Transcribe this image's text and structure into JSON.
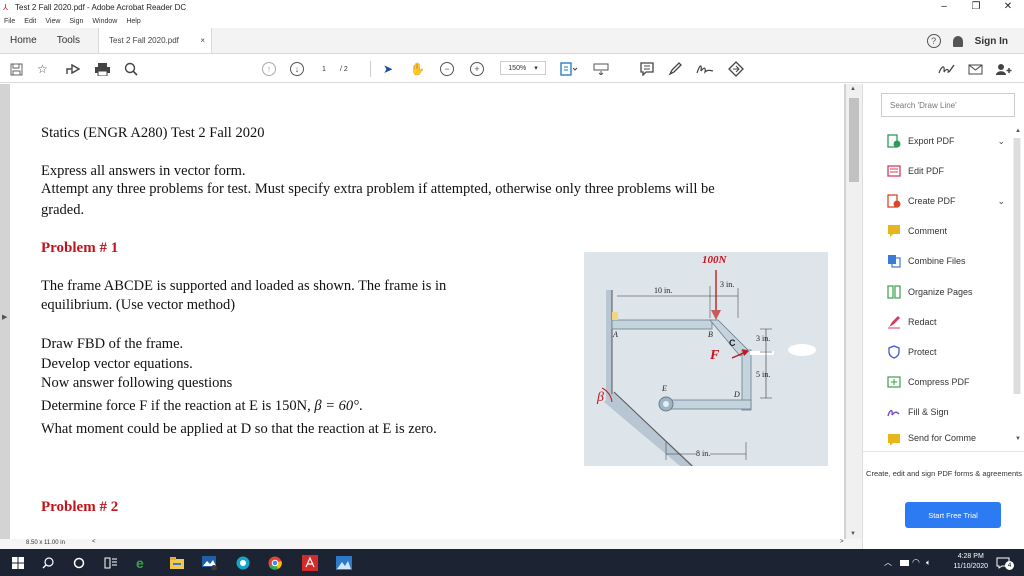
{
  "window": {
    "title": "Test 2 Fall 2020.pdf - Adobe Acrobat Reader DC",
    "minimize": "–",
    "maximize": "❐",
    "close": "✕"
  },
  "menu": [
    "File",
    "Edit",
    "View",
    "Sign",
    "Window",
    "Help"
  ],
  "tabs": {
    "home": "Home",
    "tools": "Tools",
    "doc": "Test 2 Fall 2020.pdf",
    "doc_close": "×"
  },
  "header_right": {
    "help": "?",
    "signin": "Sign In"
  },
  "toolbar": {
    "page_current": "1",
    "page_total": "/ 2",
    "zoom": "150%"
  },
  "document": {
    "title": "Statics (ENGR A280) Test 2 Fall 2020",
    "instr1": "Express all answers in vector form.",
    "instr2a": "Attempt any three problems for test. Must specify extra problem if attempted, otherwise only three problems will be",
    "instr2b": "graded.",
    "problem1": "Problem # 1",
    "p1_desc1": "The frame ABCDE is supported and loaded as shown. The frame is in",
    "p1_desc2": "equilibrium.  (Use vector method)",
    "p1_task1": "Draw FBD of the frame.",
    "p1_task2": "Develop vector equations.",
    "p1_task3": "Now answer following questions",
    "p1_q1_pre": "Determine force F if the reaction at E is 150N,",
    "p1_q1_beta": "β = 60°",
    "p1_q1_post": ".",
    "p1_q2": "What moment could be applied at D so that the reaction at E is zero.",
    "problem2": "Problem # 2"
  },
  "figure": {
    "load": "100N",
    "dim_10in": "10 in.",
    "dim_3in_top": "3 in.",
    "dim_3in_right": "3 in.",
    "dim_5in": "5 in.",
    "dim_8in": "8 in.",
    "label_A": "A",
    "label_B": "B",
    "label_C": "C",
    "label_D": "D",
    "label_E": "E",
    "label_F": "F",
    "label_beta": "β"
  },
  "status": {
    "page_size": "8.50 x 11.00 in",
    "scroll_left": "<",
    "scroll_right": ">"
  },
  "right_panel": {
    "search_placeholder": "Search 'Draw Line'",
    "tools": [
      {
        "label": "Export PDF",
        "icon": "export-pdf-icon",
        "color": "#2c9a5a",
        "has_chevron": true
      },
      {
        "label": "Edit PDF",
        "icon": "edit-pdf-icon",
        "color": "#d83b5f",
        "has_chevron": false
      },
      {
        "label": "Create PDF",
        "icon": "create-pdf-icon",
        "color": "#d9482b",
        "has_chevron": true
      },
      {
        "label": "Comment",
        "icon": "comment-icon",
        "color": "#e7b61e",
        "has_chevron": false
      },
      {
        "label": "Combine Files",
        "icon": "combine-files-icon",
        "color": "#3a7bd5",
        "has_chevron": false
      },
      {
        "label": "Organize Pages",
        "icon": "organize-pages-icon",
        "color": "#3aa14a",
        "has_chevron": false
      },
      {
        "label": "Redact",
        "icon": "redact-icon",
        "color": "#d83b5f",
        "has_chevron": false
      },
      {
        "label": "Protect",
        "icon": "protect-icon",
        "color": "#3a5bd5",
        "has_chevron": false
      },
      {
        "label": "Compress PDF",
        "icon": "compress-pdf-icon",
        "color": "#3aa14a",
        "has_chevron": false
      },
      {
        "label": "Fill & Sign",
        "icon": "fill-sign-icon",
        "color": "#7a4ad5",
        "has_chevron": false
      },
      {
        "label": "Send for Comme",
        "icon": "send-comment-icon",
        "color": "#e7b61e",
        "has_chevron": false
      }
    ],
    "promo": "Create, edit and sign PDF forms & agreements",
    "start_trial": "Start Free Trial"
  },
  "taskbar": {
    "time": "4:28 PM",
    "date": "11/10/2020",
    "notification_count": "4"
  }
}
